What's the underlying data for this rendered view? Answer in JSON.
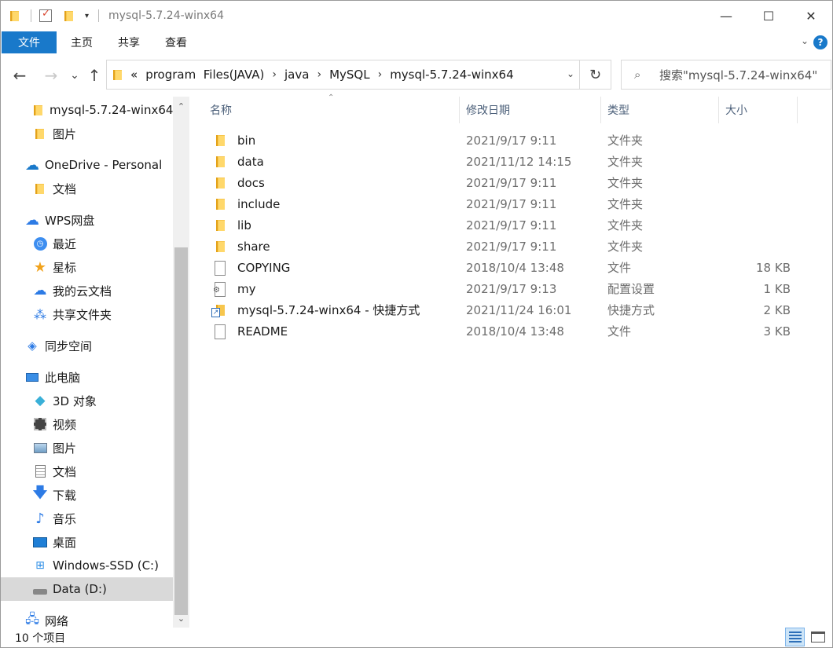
{
  "window": {
    "title": "mysql-5.7.24-winx64",
    "minimize_glyph": "—",
    "maximize_glyph": "☐",
    "close_glyph": "✕"
  },
  "ribbon": {
    "tabs": [
      "文件",
      "主页",
      "共享",
      "查看"
    ]
  },
  "navigation": {
    "back_glyph": "←",
    "forward_glyph": "→",
    "recent_glyph": "⌄",
    "up_glyph": "↑"
  },
  "address": {
    "overflow": "«",
    "crumbs": [
      "program  Files(JAVA)",
      "java",
      "MySQL",
      "mysql-5.7.24-winx64"
    ],
    "separator": "›"
  },
  "search": {
    "placeholder": "搜索\"mysql-5.7.24-winx64\""
  },
  "nav_pane": {
    "items": [
      {
        "label": "mysql-5.7.24-winx64",
        "icon": "folder-icon"
      },
      {
        "label": "图片",
        "icon": "folder-icon"
      },
      {
        "label": "OneDrive - Personal",
        "icon": "onedrive-cloud-icon"
      },
      {
        "label": "文档",
        "icon": "folder-icon"
      },
      {
        "label": "WPS网盘",
        "icon": "wps-cloud-icon"
      },
      {
        "label": "最近",
        "icon": "clock-icon"
      },
      {
        "label": "星标",
        "icon": "star-icon"
      },
      {
        "label": "我的云文档",
        "icon": "cloud-docs-icon"
      },
      {
        "label": "共享文件夹",
        "icon": "share-icon"
      },
      {
        "label": "同步空间",
        "icon": "sync-icon"
      },
      {
        "label": "此电脑",
        "icon": "computer-icon"
      },
      {
        "label": "3D 对象",
        "icon": "cube-icon"
      },
      {
        "label": "视频",
        "icon": "film-icon"
      },
      {
        "label": "图片",
        "icon": "picture-icon"
      },
      {
        "label": "文档",
        "icon": "document-icon"
      },
      {
        "label": "下载",
        "icon": "download-icon"
      },
      {
        "label": "音乐",
        "icon": "music-icon"
      },
      {
        "label": "桌面",
        "icon": "desktop-icon"
      },
      {
        "label": "Windows-SSD (C:)",
        "icon": "windows-drive-icon"
      },
      {
        "label": "Data (D:)",
        "icon": "drive-icon"
      },
      {
        "label": "网络",
        "icon": "network-icon"
      }
    ]
  },
  "columns": {
    "name": "名称",
    "date": "修改日期",
    "type": "类型",
    "size": "大小"
  },
  "files": [
    {
      "name": "bin",
      "date": "2021/9/17 9:11",
      "type": "文件夹",
      "size": "",
      "icon": "folder"
    },
    {
      "name": "data",
      "date": "2021/11/12 14:15",
      "type": "文件夹",
      "size": "",
      "icon": "folder"
    },
    {
      "name": "docs",
      "date": "2021/9/17 9:11",
      "type": "文件夹",
      "size": "",
      "icon": "folder"
    },
    {
      "name": "include",
      "date": "2021/9/17 9:11",
      "type": "文件夹",
      "size": "",
      "icon": "folder"
    },
    {
      "name": "lib",
      "date": "2021/9/17 9:11",
      "type": "文件夹",
      "size": "",
      "icon": "folder"
    },
    {
      "name": "share",
      "date": "2021/9/17 9:11",
      "type": "文件夹",
      "size": "",
      "icon": "folder"
    },
    {
      "name": "COPYING",
      "date": "2018/10/4 13:48",
      "type": "文件",
      "size": "18 KB",
      "icon": "doc"
    },
    {
      "name": "my",
      "date": "2021/9/17 9:13",
      "type": "配置设置",
      "size": "1 KB",
      "icon": "cfg"
    },
    {
      "name": "mysql-5.7.24-winx64 - 快捷方式",
      "date": "2021/11/24 16:01",
      "type": "快捷方式",
      "size": "2 KB",
      "icon": "lnk"
    },
    {
      "name": "README",
      "date": "2018/10/4 13:48",
      "type": "文件",
      "size": "3 KB",
      "icon": "doc"
    }
  ],
  "status": {
    "item_count": "10 个项目"
  },
  "colors": {
    "accent": "#1979ca",
    "selected_nav": "#d9d9d9"
  }
}
